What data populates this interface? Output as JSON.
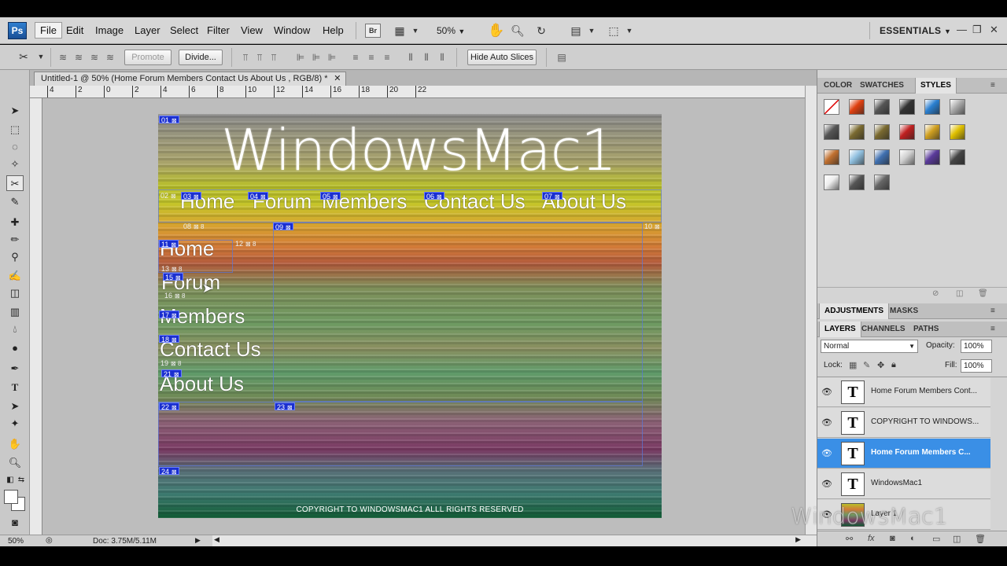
{
  "app": {
    "logo": "Ps"
  },
  "menu": [
    "File",
    "Edit",
    "Image",
    "Layer",
    "Select",
    "Filter",
    "View",
    "Window",
    "Help"
  ],
  "menubar": {
    "bridge_label": "Br",
    "zoom": "50%",
    "workspace": "ESSENTIALS",
    "win_min": "—",
    "win_restore": "❐",
    "win_close": "✕"
  },
  "options": {
    "promote_label": "Promote",
    "divide_label": "Divide...",
    "hide_auto_slices_label": "Hide Auto Slices"
  },
  "document": {
    "tab_title": "Untitled-1 @ 50% (Home  Forum Members Contact Us About Us , RGB/8) *",
    "close": "✕"
  },
  "ruler": {
    "top_ticks": [
      "4",
      "2",
      "0",
      "2",
      "4",
      "6",
      "8",
      "10",
      "12",
      "14",
      "16",
      "18",
      "20",
      "22"
    ]
  },
  "canvas": {
    "site_title": "WindowsMac1",
    "top_nav": [
      "Home",
      "Forum",
      "Members",
      "Contact Us",
      "About Us"
    ],
    "side_nav": [
      "Home",
      "Forum",
      "Members",
      "Contact Us",
      "About Us"
    ],
    "footer": "COPYRIGHT TO WINDOWSMAC1 ALLL RIGHTS RESERVED",
    "slices": [
      {
        "num": "01",
        "auto": false
      },
      {
        "num": "02",
        "auto": false
      },
      {
        "num": "03",
        "auto": false
      },
      {
        "num": "04",
        "auto": false
      },
      {
        "num": "05",
        "auto": false
      },
      {
        "num": "06",
        "auto": false
      },
      {
        "num": "07",
        "auto": false
      },
      {
        "num": "08",
        "auto": true
      },
      {
        "num": "09",
        "auto": false
      },
      {
        "num": "10",
        "auto": true
      },
      {
        "num": "11",
        "auto": false
      },
      {
        "num": "12",
        "auto": true
      },
      {
        "num": "13",
        "auto": true
      },
      {
        "num": "15",
        "auto": false
      },
      {
        "num": "16",
        "auto": true
      },
      {
        "num": "17",
        "auto": false
      },
      {
        "num": "18",
        "auto": false
      },
      {
        "num": "19",
        "auto": true
      },
      {
        "num": "21",
        "auto": false
      },
      {
        "num": "22",
        "auto": false
      },
      {
        "num": "23",
        "auto": false
      },
      {
        "num": "24",
        "auto": false
      }
    ]
  },
  "panels": {
    "color_tabs": [
      "COLOR",
      "SWATCHES",
      "STYLES"
    ],
    "adjust_tabs": [
      "ADJUSTMENTS",
      "MASKS"
    ],
    "layer_tabs": [
      "LAYERS",
      "CHANNELS",
      "PATHS"
    ],
    "blend_mode": "Normal",
    "opacity_label": "Opacity:",
    "opacity": "100%",
    "lock_label": "Lock:",
    "fill_label": "Fill:",
    "fill": "100%",
    "layers": [
      {
        "name": "Home  Forum Members Cont...",
        "type": "T",
        "selected": false
      },
      {
        "name": "COPYRIGHT TO WINDOWS...",
        "type": "T",
        "selected": false
      },
      {
        "name": "Home  Forum Members C...",
        "type": "T",
        "selected": true
      },
      {
        "name": "WindowsMac1",
        "type": "T",
        "selected": false
      },
      {
        "name": "Layer 1",
        "type": "image",
        "selected": false
      }
    ],
    "style_colors": [
      "#ffffff",
      "#e04010",
      "#555555",
      "#333333",
      "#2a7fd0",
      "#aaaaaa",
      "#555555",
      "#7a6a30",
      "#7a6a30",
      "#c02020",
      "#d0a020",
      "#e0c000",
      "#c07030",
      "#90c0e0",
      "#4070b0",
      "#d0d0d0",
      "#5a3a9a",
      "#444444",
      "#eeeeee",
      "#555555",
      "#666666"
    ]
  },
  "status": {
    "zoom": "50%",
    "doc_info": "Doc: 3.75M/5.11M"
  },
  "watermark": "WindowsMac1"
}
